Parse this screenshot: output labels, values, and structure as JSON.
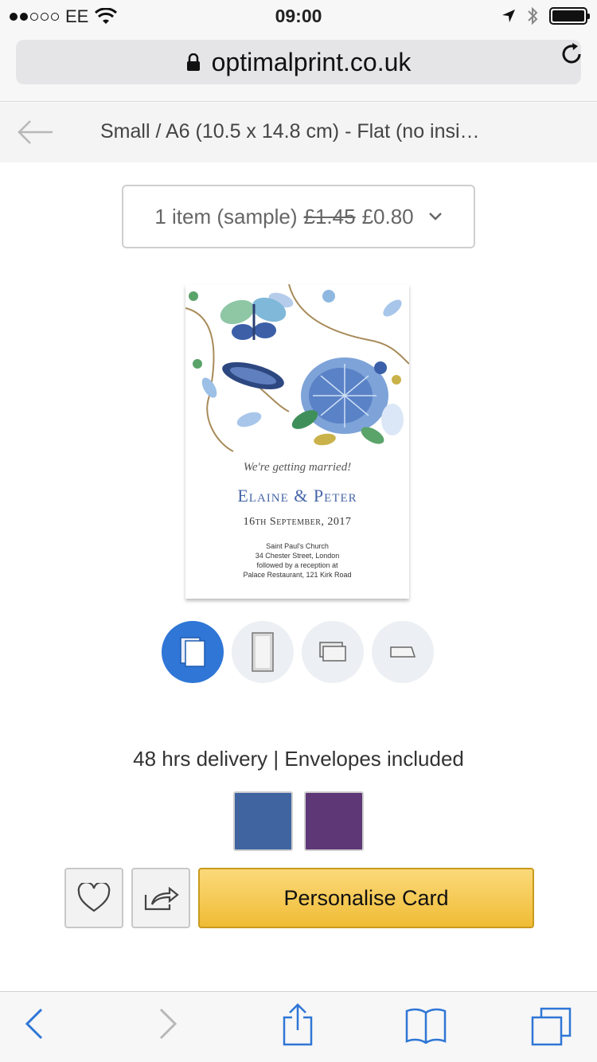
{
  "status_bar": {
    "carrier": "EE",
    "time": "09:00"
  },
  "browser": {
    "url": "optimalprint.co.uk"
  },
  "nav": {
    "title": "Small / A6 (10.5 x 14.8 cm) - Flat (no insi…"
  },
  "quantity": {
    "label": "1 item (sample)",
    "old_price": "£1.45",
    "price": "£0.80"
  },
  "card": {
    "tagline": "We're getting married!",
    "names": "Elaine & Peter",
    "date": "16th September, 2017",
    "venue_1": "Saint Paul's Church",
    "venue_2": "34 Chester Street, London",
    "venue_3": "followed by a reception at",
    "venue_4": "Palace Restaurant, 121 Kirk Road"
  },
  "views": {
    "active_index": 0
  },
  "delivery": {
    "text": "48 hrs delivery | Envelopes included"
  },
  "swatches": [
    {
      "color": "#3f64a0"
    },
    {
      "color": "#5e3777"
    }
  ],
  "actions": {
    "cta_label": "Personalise Card"
  },
  "colors": {
    "accent": "#2f76d6",
    "cta": "#f0bc35",
    "safari_blue": "#2f76d6"
  }
}
